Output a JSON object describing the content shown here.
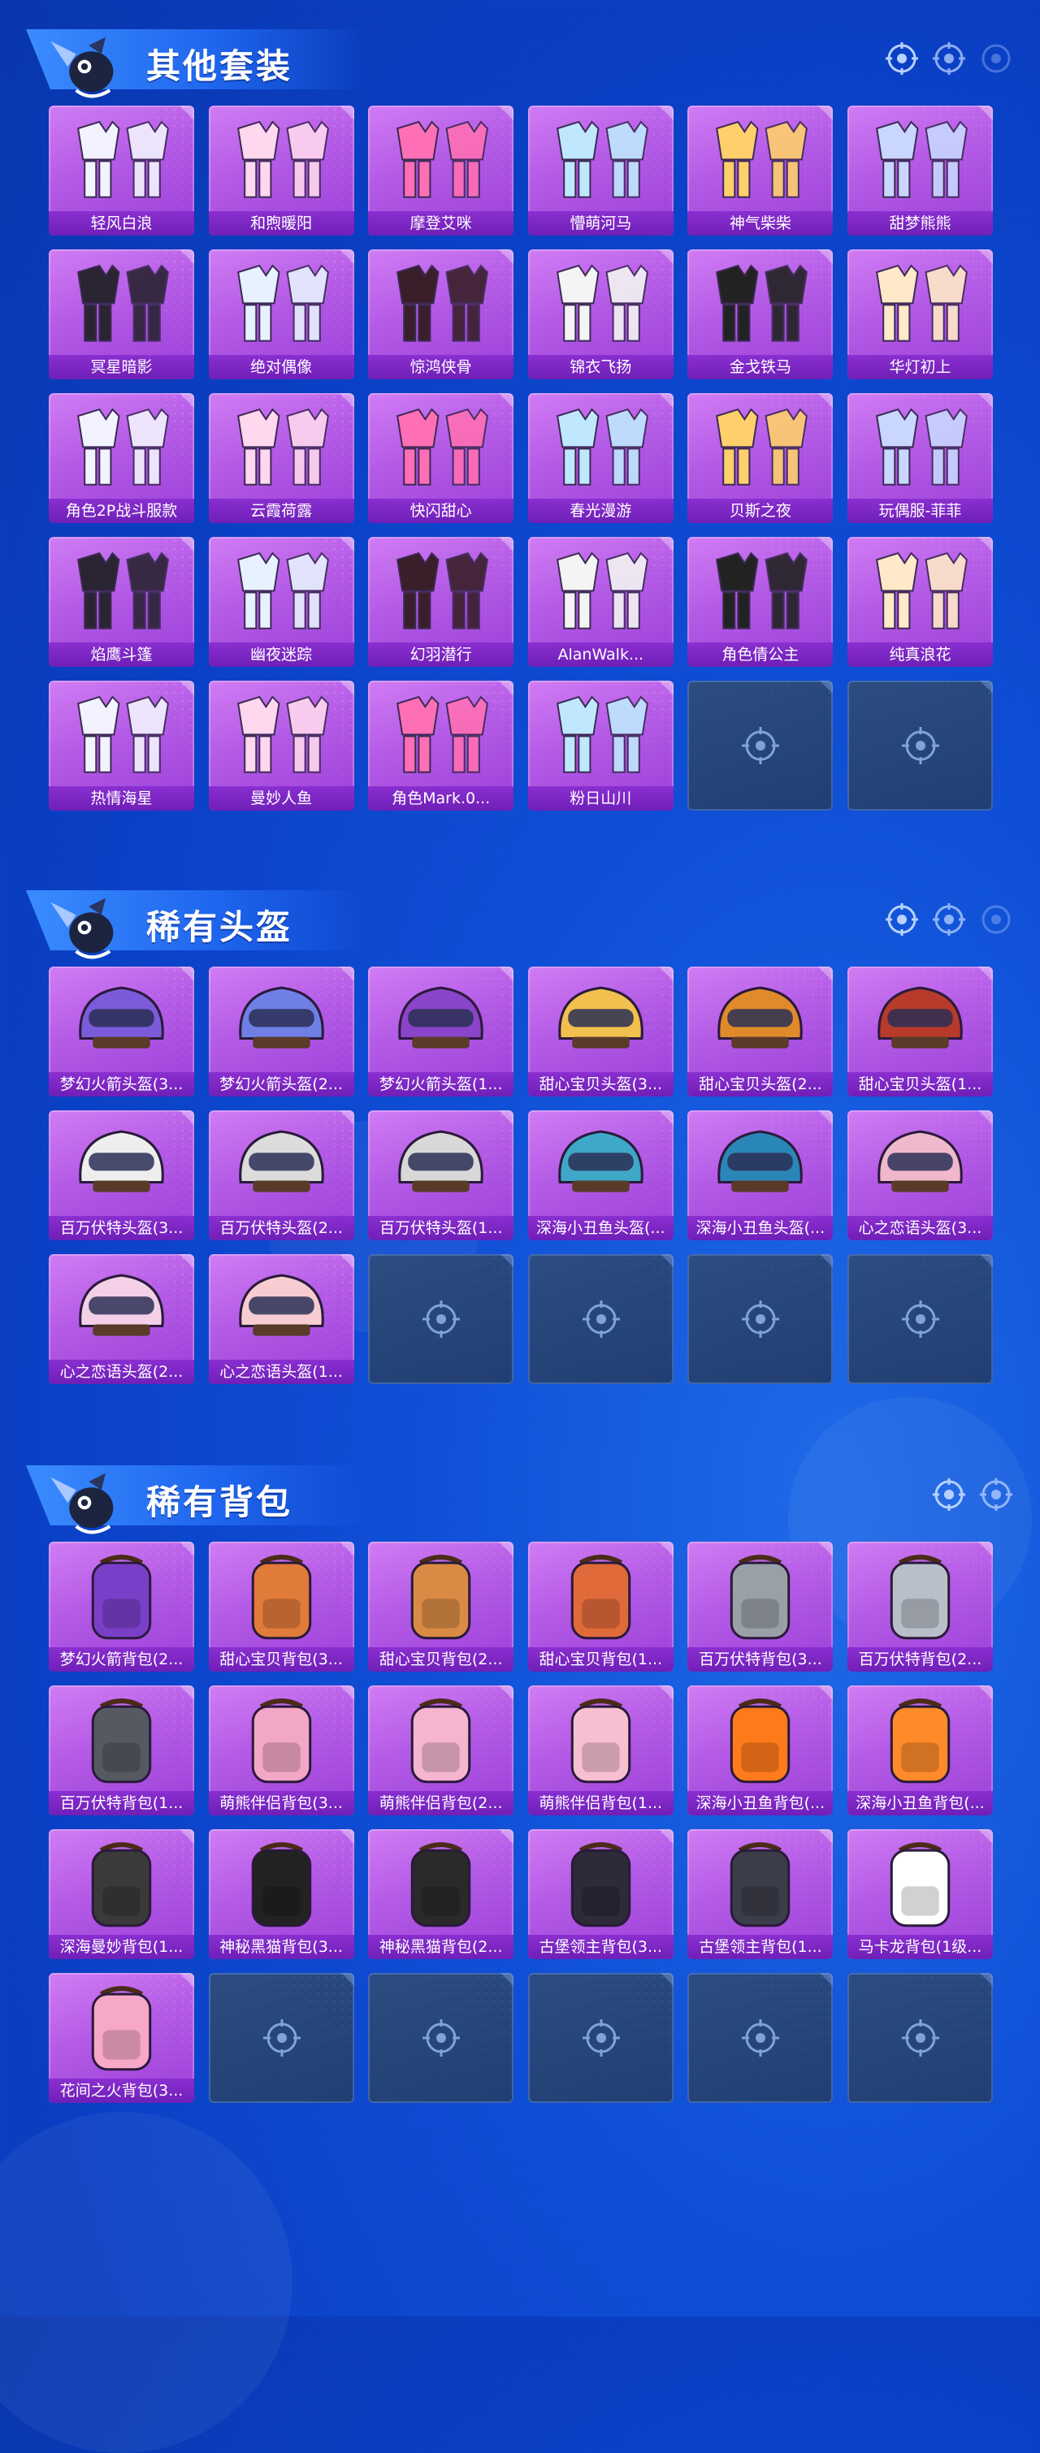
{
  "colors": {
    "background": "#0f4fd6",
    "card_purple": "#b35ae6",
    "label_purple": "#7a26c4",
    "empty_slot": "#24457a"
  },
  "sections": [
    {
      "title": "其他套装",
      "category_icon": "outfit",
      "items": [
        {
          "label": "轻风白浪",
          "icon": "outfit-icon"
        },
        {
          "label": "和煦暖阳",
          "icon": "outfit-icon"
        },
        {
          "label": "摩登艾咪",
          "icon": "outfit-icon"
        },
        {
          "label": "懵萌河马",
          "icon": "outfit-icon"
        },
        {
          "label": "神气柴柴",
          "icon": "outfit-icon"
        },
        {
          "label": "甜梦熊熊",
          "icon": "outfit-icon"
        },
        {
          "label": "冥星暗影",
          "icon": "outfit-icon"
        },
        {
          "label": "绝对偶像",
          "icon": "outfit-icon"
        },
        {
          "label": "惊鸿侠骨",
          "icon": "outfit-icon"
        },
        {
          "label": "锦衣飞扬",
          "icon": "outfit-icon"
        },
        {
          "label": "金戈铁马",
          "icon": "outfit-icon"
        },
        {
          "label": "华灯初上",
          "icon": "outfit-icon"
        },
        {
          "label": "角色2P战斗服款",
          "icon": "outfit-icon"
        },
        {
          "label": "云霞荷露",
          "icon": "outfit-icon"
        },
        {
          "label": "快闪甜心",
          "icon": "outfit-icon"
        },
        {
          "label": "春光漫游",
          "icon": "outfit-icon"
        },
        {
          "label": "贝斯之夜",
          "icon": "outfit-icon"
        },
        {
          "label": "玩偶服-菲菲",
          "icon": "outfit-icon"
        },
        {
          "label": "焰鹰斗篷",
          "icon": "outfit-icon"
        },
        {
          "label": "幽夜迷踪",
          "icon": "outfit-icon"
        },
        {
          "label": "幻羽潜行",
          "icon": "outfit-icon"
        },
        {
          "label": "AlanWalk...",
          "icon": "outfit-icon"
        },
        {
          "label": "角色倩公主",
          "icon": "outfit-icon"
        },
        {
          "label": "纯真浪花",
          "icon": "outfit-icon"
        },
        {
          "label": "热情海星",
          "icon": "outfit-icon"
        },
        {
          "label": "曼妙人鱼",
          "icon": "outfit-icon"
        },
        {
          "label": "角色Mark.0...",
          "icon": "outfit-icon"
        },
        {
          "label": "粉日山川",
          "icon": "outfit-icon"
        }
      ],
      "empty_slots": 2
    },
    {
      "title": "稀有头盔",
      "category_icon": "helmet",
      "items": [
        {
          "label": "梦幻火箭头盔(3...",
          "icon": "helmet-icon"
        },
        {
          "label": "梦幻火箭头盔(2...",
          "icon": "helmet-icon"
        },
        {
          "label": "梦幻火箭头盔(1...",
          "icon": "helmet-icon"
        },
        {
          "label": "甜心宝贝头盔(3...",
          "icon": "helmet-icon"
        },
        {
          "label": "甜心宝贝头盔(2...",
          "icon": "helmet-icon"
        },
        {
          "label": "甜心宝贝头盔(1...",
          "icon": "helmet-icon"
        },
        {
          "label": "百万伏特头盔(3...",
          "icon": "helmet-icon"
        },
        {
          "label": "百万伏特头盔(2...",
          "icon": "helmet-icon"
        },
        {
          "label": "百万伏特头盔(1...",
          "icon": "helmet-icon"
        },
        {
          "label": "深海小丑鱼头盔(...",
          "icon": "helmet-icon"
        },
        {
          "label": "深海小丑鱼头盔(...",
          "icon": "helmet-icon"
        },
        {
          "label": "心之恋语头盔(3...",
          "icon": "helmet-icon"
        },
        {
          "label": "心之恋语头盔(2...",
          "icon": "helmet-icon"
        },
        {
          "label": "心之恋语头盔(1...",
          "icon": "helmet-icon"
        }
      ],
      "empty_slots": 4
    },
    {
      "title": "稀有背包",
      "category_icon": "backpack",
      "items": [
        {
          "label": "梦幻火箭背包(2...",
          "icon": "backpack-icon"
        },
        {
          "label": "甜心宝贝背包(3...",
          "icon": "backpack-icon"
        },
        {
          "label": "甜心宝贝背包(2...",
          "icon": "backpack-icon"
        },
        {
          "label": "甜心宝贝背包(1...",
          "icon": "backpack-icon"
        },
        {
          "label": "百万伏特背包(3...",
          "icon": "backpack-icon"
        },
        {
          "label": "百万伏特背包(2...",
          "icon": "backpack-icon"
        },
        {
          "label": "百万伏特背包(1...",
          "icon": "backpack-icon"
        },
        {
          "label": "萌熊伴侣背包(3...",
          "icon": "backpack-icon"
        },
        {
          "label": "萌熊伴侣背包(2...",
          "icon": "backpack-icon"
        },
        {
          "label": "萌熊伴侣背包(1...",
          "icon": "backpack-icon"
        },
        {
          "label": "深海小丑鱼背包(...",
          "icon": "backpack-icon"
        },
        {
          "label": "深海小丑鱼背包(...",
          "icon": "backpack-icon"
        },
        {
          "label": "深海曼妙背包(1...",
          "icon": "backpack-icon"
        },
        {
          "label": "神秘黑猫背包(3...",
          "icon": "backpack-icon"
        },
        {
          "label": "神秘黑猫背包(2...",
          "icon": "backpack-icon"
        },
        {
          "label": "古堡领主背包(3...",
          "icon": "backpack-icon"
        },
        {
          "label": "古堡领主背包(1...",
          "icon": "backpack-icon"
        },
        {
          "label": "马卡龙背包(1级...",
          "icon": "backpack-icon"
        },
        {
          "label": "花间之火背包(3...",
          "icon": "backpack-icon"
        }
      ],
      "empty_slots": 5
    }
  ]
}
